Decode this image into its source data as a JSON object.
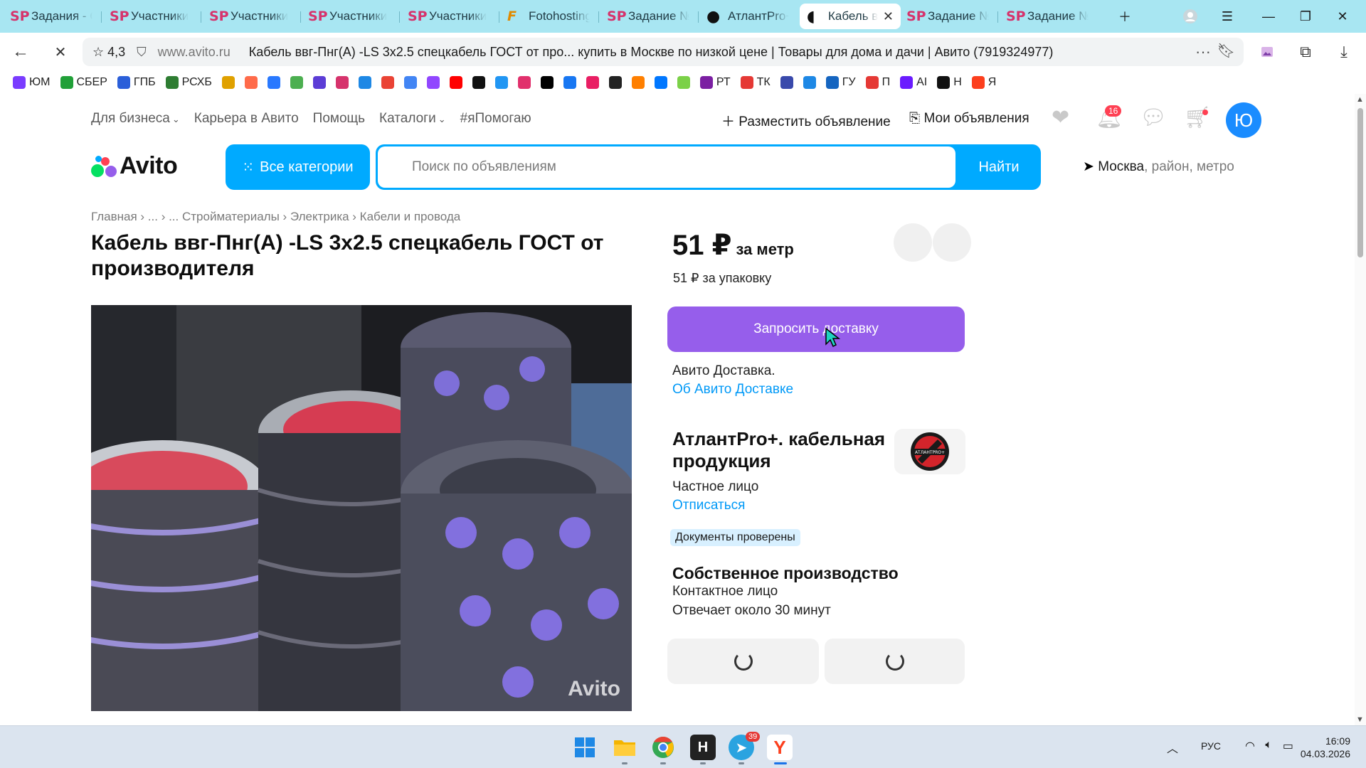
{
  "browser": {
    "tabs": [
      {
        "icon": "SP",
        "title": "Задания - С"
      },
      {
        "icon": "SP",
        "title": "Участники"
      },
      {
        "icon": "SP",
        "title": "Участники"
      },
      {
        "icon": "SP",
        "title": "Участники"
      },
      {
        "icon": "SP",
        "title": "Участники"
      },
      {
        "icon": "F",
        "title": "Fotohosting"
      },
      {
        "icon": "SP",
        "title": "Задание №"
      },
      {
        "icon": "●",
        "title": "АтлантPro+"
      },
      {
        "icon": "◖",
        "title": "Кабель в"
      },
      {
        "icon": "SP",
        "title": "Задание №"
      },
      {
        "icon": "SP",
        "title": "Задание №"
      }
    ],
    "active_tab_index": 8,
    "rating": "4,3",
    "domain": "www.avito.ru",
    "page_title": "Кабель ввг-Пнг(А) -LS 3х2.5 спецкабель ГОСТ от про... купить в Москве по низкой цене | Товары для дома и дачи | Авито (7919324977)",
    "bookmarks": [
      {
        "label": "ЮМ",
        "color": "#7a3cff"
      },
      {
        "label": "СБЕР",
        "color": "#21a038"
      },
      {
        "label": "ГПБ",
        "color": "#2b5fd9"
      },
      {
        "label": "РСХБ",
        "color": "#2e7d32"
      },
      {
        "label": "",
        "color": "#e0a100"
      },
      {
        "label": "",
        "color": "#ff6b4a"
      },
      {
        "label": "",
        "color": "#2979ff"
      },
      {
        "label": "",
        "color": "#4caf50"
      },
      {
        "label": "",
        "color": "#5c3dd6"
      },
      {
        "label": "",
        "color": "#d6336c"
      },
      {
        "label": "",
        "color": "#1e88e5"
      },
      {
        "label": "",
        "color": "#ea4335"
      },
      {
        "label": "",
        "color": "#4285f4"
      },
      {
        "label": "",
        "color": "#9146ff"
      },
      {
        "label": "",
        "color": "#ff0000"
      },
      {
        "label": "",
        "color": "#111111"
      },
      {
        "label": "",
        "color": "#2196f3"
      },
      {
        "label": "",
        "color": "#e1306c"
      },
      {
        "label": "",
        "color": "#000000"
      },
      {
        "label": "",
        "color": "#1877f2"
      },
      {
        "label": "",
        "color": "#e91e63"
      },
      {
        "label": "",
        "color": "#222222"
      },
      {
        "label": "",
        "color": "#ff7f00"
      },
      {
        "label": "",
        "color": "#0077ff"
      },
      {
        "label": "",
        "color": "#7bd148"
      },
      {
        "label": "РТ",
        "color": "#7b1fa2"
      },
      {
        "label": "ТК",
        "color": "#e53935"
      },
      {
        "label": "",
        "color": "#3949ab"
      },
      {
        "label": "",
        "color": "#1e88e5"
      },
      {
        "label": "ГУ",
        "color": "#1565c0"
      },
      {
        "label": "П",
        "color": "#e53935"
      },
      {
        "label": "AI",
        "color": "#6a1bff"
      },
      {
        "label": "Н",
        "color": "#111111"
      },
      {
        "label": "Я",
        "color": "#fc3f1d"
      }
    ]
  },
  "header": {
    "nav": [
      "Для бизнеса",
      "Карьера в Авито",
      "Помощь",
      "Каталоги",
      "#яПомогаю"
    ],
    "post_ad": "Разместить объявление",
    "my_ads": "Мои объявления",
    "notifications_count": "16",
    "avatar_letter": "Ю",
    "logo_text": "Avito",
    "all_categories": "Все категории",
    "search_placeholder": "Поиск по объявлениям",
    "search_button": "Найти",
    "location_city": "Москва",
    "location_rest": ", район, метро",
    "colors": {
      "accent": "#00aaff",
      "purple": "#965eeb",
      "link": "#0099f7",
      "badge": "#ff4053"
    }
  },
  "listing": {
    "breadcrumb": "Главная › ... › ... Стройматериалы › Электрика › Кабели и провода",
    "title": "Кабель ввг-Пнг(А) -LS 3х2.5 спецкабель ГОСТ от производителя",
    "photo_watermark": "Avito",
    "price": "51 ₽",
    "price_unit": "за метр",
    "pack_price": "51 ₽ за упаковку",
    "request_delivery": "Запросить доставку",
    "delivery_text": "Авито Доставка.",
    "delivery_link": "Об Авито Доставке"
  },
  "seller": {
    "name": "АтлантPro+. кабельная продукция",
    "logo_text": "АТЛАНТPRO+",
    "type": "Частное лицо",
    "unsubscribe": "Отписаться",
    "docs_badge": "Документы проверены",
    "own_production": "Собственное производство",
    "contact_person": "Контактное лицо",
    "response_time": "Отвечает около 30 минут"
  },
  "taskbar": {
    "telegram_badge": "39",
    "language": "РУС",
    "time": "16:09",
    "date": "04.03.2026"
  }
}
